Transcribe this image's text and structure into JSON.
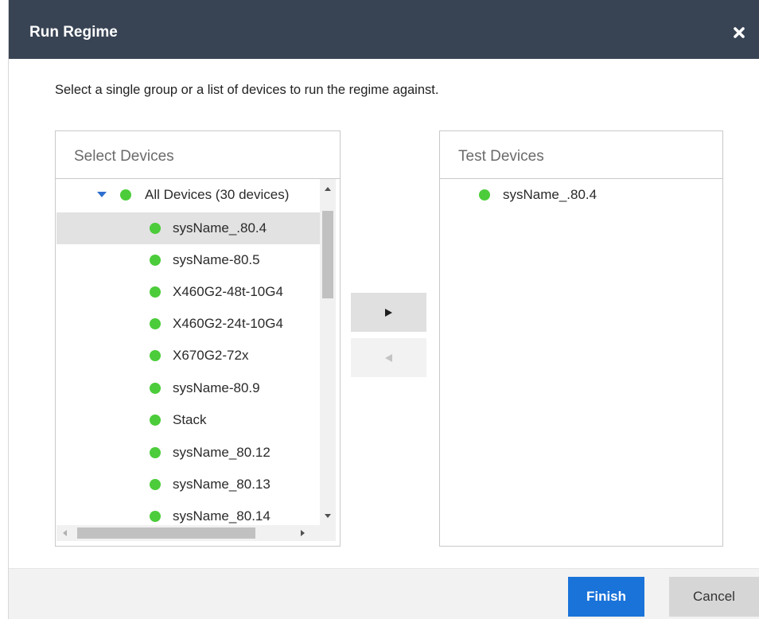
{
  "dialog": {
    "title": "Run Regime",
    "instructions": "Select a single group or a list of devices to run the regime against."
  },
  "select_panel": {
    "title": "Select Devices",
    "root": {
      "label": "All Devices (30 devices)",
      "expanded": true
    },
    "items": [
      {
        "label": "sysName_.80.4",
        "selected": true
      },
      {
        "label": "sysName-80.5",
        "selected": false
      },
      {
        "label": "X460G2-48t-10G4",
        "selected": false
      },
      {
        "label": "X460G2-24t-10G4",
        "selected": false
      },
      {
        "label": "X670G2-72x",
        "selected": false
      },
      {
        "label": "sysName-80.9",
        "selected": false
      },
      {
        "label": "Stack",
        "selected": false
      },
      {
        "label": "sysName_80.12",
        "selected": false
      },
      {
        "label": "sysName_80.13",
        "selected": false
      },
      {
        "label": "sysName_80.14",
        "selected": false
      }
    ]
  },
  "test_panel": {
    "title": "Test Devices",
    "items": [
      {
        "label": "sysName_.80.4"
      }
    ]
  },
  "buttons": {
    "finish": "Finish",
    "cancel": "Cancel"
  },
  "colors": {
    "titlebar": "#384454",
    "status_up": "#4ccc3a",
    "primary": "#1a73d9",
    "expand_caret": "#2f6fd0"
  },
  "icons": {
    "close": "close-icon",
    "status": "status-dot-icon",
    "expand": "caret-down-icon",
    "move_right": "arrow-right-icon",
    "move_left": "arrow-left-icon"
  }
}
